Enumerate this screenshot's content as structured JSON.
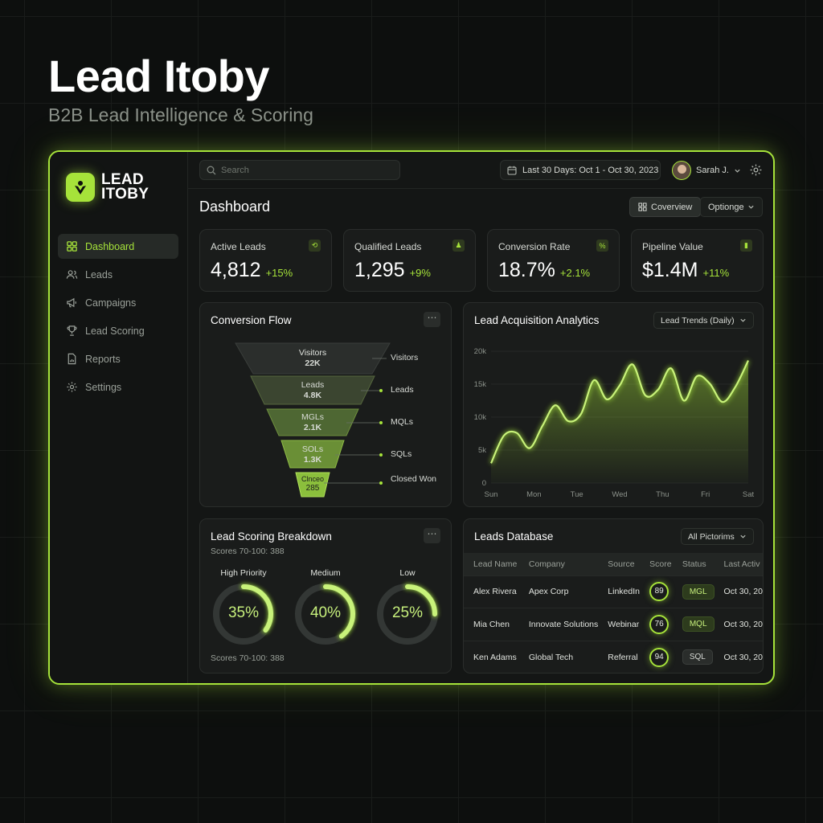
{
  "hero": {
    "title": "Lead Itoby",
    "subtitle": "B2B Lead Intelligence & Scoring"
  },
  "brand": {
    "logo_line1": "LEAD",
    "logo_line2": "ITOBY",
    "accent": "#a6e33a"
  },
  "sidebar": {
    "items": [
      {
        "label": "Dashboard",
        "icon": "grid-icon",
        "active": true
      },
      {
        "label": "Leads",
        "icon": "users-icon"
      },
      {
        "label": "Campaigns",
        "icon": "megaphone-icon"
      },
      {
        "label": "Lead Scoring",
        "icon": "trophy-icon"
      },
      {
        "label": "Reports",
        "icon": "report-icon"
      },
      {
        "label": "Settings",
        "icon": "gear-icon"
      }
    ]
  },
  "topbar": {
    "search_placeholder": "Search",
    "date_range": "Last 30 Days: Oct 1 - Oct 30, 2023",
    "user_name": "Sarah J."
  },
  "main": {
    "title": "Dashboard",
    "overview_label": "Coverview",
    "options_label": "Optionge"
  },
  "kpis": [
    {
      "label": "Active Leads",
      "value": "4,812",
      "delta": "+15%"
    },
    {
      "label": "Qualified Leads",
      "value": "1,295",
      "delta": "+9%"
    },
    {
      "label": "Conversion Rate",
      "value": "18.7%",
      "delta": "+2.1%"
    },
    {
      "label": "Pipeline Value",
      "value": "$1.4M",
      "delta": "+11%"
    }
  ],
  "funnel": {
    "title": "Conversion Flow",
    "stages": [
      {
        "name": "Visitors",
        "value": "22K",
        "side_label": "Visitors"
      },
      {
        "name": "Leads",
        "value": "4.8K",
        "side_label": "Leads"
      },
      {
        "name": "MGLs",
        "value": "2.1K",
        "side_label": "MQLs"
      },
      {
        "name": "SOLs",
        "value": "1.3K",
        "side_label": "SQLs"
      },
      {
        "name": "Clnceo",
        "value": "285",
        "side_label": "Closed Won"
      }
    ]
  },
  "acquisition": {
    "title": "Lead Acquisition Analytics",
    "dropdown": "Lead Trends (Daily)"
  },
  "chart_data": {
    "type": "area",
    "x_tick_labels": [
      "Sun",
      "Mon",
      "Tue",
      "Wed",
      "Thu",
      "Fri",
      "Sat"
    ],
    "y_tick_labels": [
      "20k",
      "15k",
      "10k",
      "5k",
      "0"
    ],
    "ylim": [
      0,
      20000
    ],
    "x": [
      0,
      0.3,
      0.6,
      0.9,
      1.2,
      1.5,
      1.8,
      2.1,
      2.4,
      2.7,
      3.0,
      3.3,
      3.6,
      3.9,
      4.2,
      4.5,
      4.8,
      5.1,
      5.4,
      5.7,
      6.0
    ],
    "values": [
      3000,
      7200,
      7600,
      5300,
      8700,
      11800,
      9400,
      10500,
      15600,
      12700,
      14800,
      18000,
      13300,
      14200,
      17400,
      12500,
      16200,
      15100,
      12300,
      14600,
      18600
    ],
    "color": "#a6e33a"
  },
  "scoring": {
    "title": "Lead Scoring Breakdown",
    "subtitle": "Scores 70-100: 388",
    "footer": "Scores 70-100: 388",
    "segments": [
      {
        "label": "High Priority",
        "pct_text": "35%",
        "pct": 35
      },
      {
        "label": "Medium",
        "pct_text": "40%",
        "pct": 40
      },
      {
        "label": "Low",
        "pct_text": "25%",
        "pct": 25
      }
    ]
  },
  "leads_db": {
    "title": "Leads Database",
    "filter": "All Pictorims",
    "columns": [
      "Lead Name",
      "Company",
      "Source",
      "Score",
      "Status",
      "Last Activ"
    ],
    "rows": [
      {
        "name": "Alex Rivera",
        "company": "Apex Corp",
        "source": "LinkedIn",
        "score": "89",
        "status": "MGL",
        "last": "Oct 30, 20"
      },
      {
        "name": "Mia Chen",
        "company": "Innovate Solutions",
        "source": "Webinar",
        "score": "76",
        "status": "MQL",
        "last": "Oct 30, 20"
      },
      {
        "name": "Ken Adams",
        "company": "Global Tech",
        "source": "Referral",
        "score": "94",
        "status": "SQL",
        "last": "Oct 30, 20"
      }
    ]
  }
}
